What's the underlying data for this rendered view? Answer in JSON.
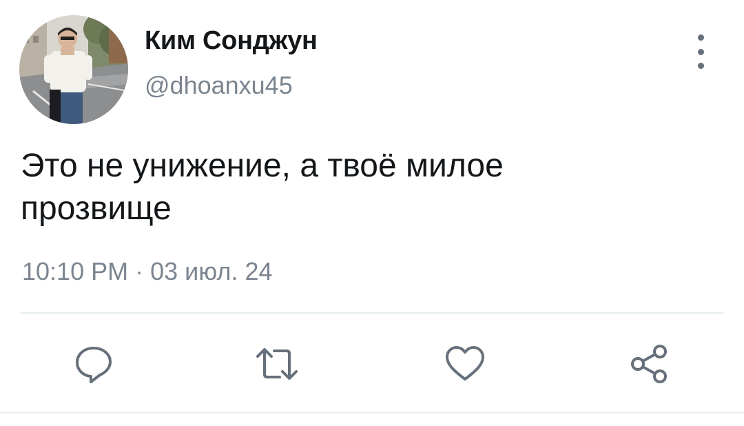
{
  "tweet": {
    "author_name": "Ким Сонджун",
    "author_handle": "@dhoanxu45",
    "text": "Это не унижение, а твоё милое\nпрозвище",
    "timestamp": "10:10 PM · 03 июл. 24"
  },
  "icons": {
    "more": "more-vertical-icon",
    "reply": "reply-icon",
    "retweet": "retweet-icon",
    "like": "heart-icon",
    "share": "share-icon"
  },
  "colors": {
    "text": "#14171a",
    "secondary_text": "#7b8590",
    "icon": "#66707a",
    "divider": "#e6ecf0"
  }
}
